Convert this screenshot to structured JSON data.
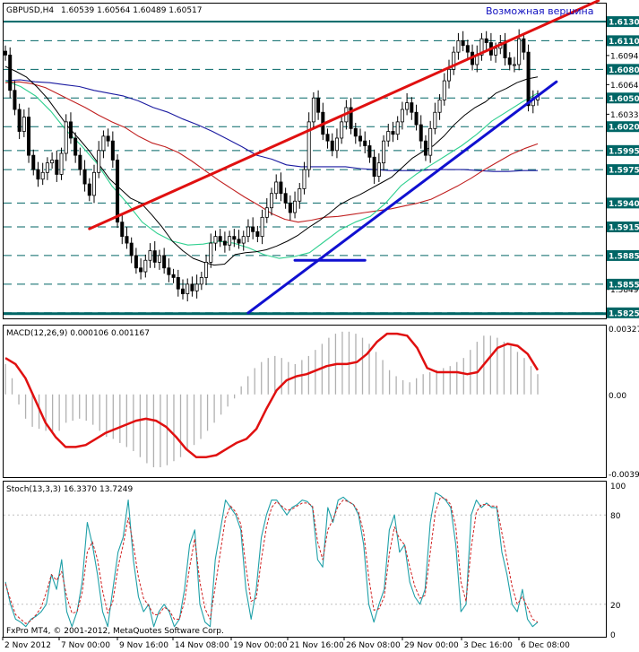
{
  "header": {
    "symbol": "GBPUSD,H4",
    "ohlc": "1.60539 1.60564 1.60489 1.60517"
  },
  "annotation": "Возможная вершина",
  "footer": "FxPro MT4, © 2001-2012, MetaQuotes Software Corp.",
  "colors": {
    "price_box": "#006666",
    "dash_line": "#006666",
    "candle": "#000000",
    "red_channel": "#e01010",
    "blue_trend": "#1010d0",
    "ma_black": "#000000",
    "ma_navy": "#1a1aa0",
    "ma_red": "#c02020",
    "ma_green": "#2fd090",
    "macd_hist": "#b0b0b0",
    "macd_signal": "#e01010",
    "stoch_main": "#1fa0a8",
    "stoch_signal": "#d02020",
    "annotation": "#1010c0"
  },
  "chart_data": [
    {
      "type": "candlestick",
      "title": "GBPUSD,H4",
      "ylim": [
        1.5822,
        1.6147
      ],
      "x_tick_labels": [
        "2 Nov 2012",
        "7 Nov 00:00",
        "9 Nov 16:00",
        "14 Nov 08:00",
        "19 Nov 00:00",
        "21 Nov 16:00",
        "26 Nov 08:00",
        "29 Nov 00:00",
        "3 Dec 16:00",
        "6 Dec 08:00"
      ],
      "y_tick_labels": [
        "1.61300",
        "1.61100",
        "1.60945",
        "1.60800",
        "1.60640",
        "1.60500",
        "1.60330",
        "1.60200",
        "1.59950",
        "1.59750",
        "1.59400",
        "1.59150",
        "1.58850",
        "1.58495",
        "1.58550",
        "1.58250"
      ],
      "levels": [
        1.613,
        1.611,
        1.608,
        1.605,
        1.602,
        1.5995,
        1.5975,
        1.594,
        1.5915,
        1.5885,
        1.5855,
        1.5825
      ],
      "highlighted_levels": [
        "1.61300",
        "1.61100",
        "1.60800",
        "1.60500",
        "1.60200",
        "1.59950",
        "1.59750",
        "1.59400",
        "1.59150",
        "1.58850",
        "1.58550",
        "1.58250"
      ],
      "close": [
        1.6095,
        1.6058,
        1.6038,
        1.6015,
        1.603,
        1.599,
        1.5975,
        1.5965,
        1.5972,
        1.5982,
        1.5985,
        1.597,
        1.5992,
        1.6025,
        1.6008,
        1.599,
        1.5975,
        1.596,
        1.5948,
        1.5972,
        1.5995,
        1.601,
        1.6005,
        1.5985,
        1.592,
        1.5905,
        1.5898,
        1.5885,
        1.5872,
        1.5868,
        1.588,
        1.589,
        1.5878,
        1.5885,
        1.5872,
        1.5865,
        1.5862,
        1.585,
        1.5845,
        1.5855,
        1.5848,
        1.5855,
        1.5862,
        1.5878,
        1.5898,
        1.5905,
        1.59,
        1.5896,
        1.5905,
        1.5902,
        1.5898,
        1.5905,
        1.5915,
        1.591,
        1.5905,
        1.5925,
        1.5935,
        1.595,
        1.5962,
        1.595,
        1.594,
        1.593,
        1.5942,
        1.5955,
        1.5975,
        1.6025,
        1.605,
        1.6035,
        1.6012,
        1.6005,
        1.5995,
        1.6008,
        1.6025,
        1.604,
        1.6018,
        1.601,
        1.6005,
        1.6,
        1.5988,
        1.5968,
        1.5982,
        1.6005,
        1.6015,
        1.6012,
        1.6025,
        1.6038,
        1.6045,
        1.6035,
        1.6022,
        1.6005,
        1.599,
        1.6018,
        1.6035,
        1.6048,
        1.6068,
        1.608,
        1.6098,
        1.611,
        1.6105,
        1.6098,
        1.6085,
        1.6095,
        1.6112,
        1.6108,
        1.6095,
        1.6102,
        1.6108,
        1.6092,
        1.6085,
        1.6085,
        1.6112,
        1.6098,
        1.6042,
        1.6048,
        1.6052
      ],
      "ma_black": [
        1.6083,
        1.6078,
        1.6072,
        1.6062,
        1.605,
        1.6035,
        1.602,
        1.6008,
        1.5995,
        1.598,
        1.5965,
        1.5955,
        1.5945,
        1.594,
        1.5928,
        1.5915,
        1.59,
        1.589,
        1.5882,
        1.5878,
        1.5875,
        1.5876,
        1.5886,
        1.5888,
        1.5889,
        1.5891,
        1.5895,
        1.59,
        1.5906,
        1.5914,
        1.5921,
        1.5929,
        1.5938,
        1.5944,
        1.5949,
        1.5955,
        1.5961,
        1.5967,
        1.5977,
        1.5987,
        1.5994,
        1.6,
        1.601,
        1.6022,
        1.6032,
        1.604,
        1.6046,
        1.6055,
        1.606,
        1.6066,
        1.607,
        1.6072
      ],
      "ma_navy": [
        1.6068,
        1.6069,
        1.6067,
        1.6066,
        1.6064,
        1.6062,
        1.6058,
        1.6055,
        1.6052,
        1.6047,
        1.604,
        1.6035,
        1.6028,
        1.6022,
        1.6015,
        1.6007,
        1.5999,
        1.599,
        1.5986,
        1.598,
        1.5978,
        1.5978,
        1.5978,
        1.5978,
        1.5976,
        1.5975,
        1.5974,
        1.5974,
        1.5974,
        1.5975,
        1.5975,
        1.5975,
        1.5974,
        1.5973,
        1.5973,
        1.5974,
        1.5974
      ],
      "ma_red": [
        1.6066,
        1.6067,
        1.6065,
        1.6061,
        1.6054,
        1.6047,
        1.604,
        1.6032,
        1.6025,
        1.6019,
        1.601,
        1.6003,
        1.5999,
        1.5993,
        1.5984,
        1.5974,
        1.5964,
        1.5955,
        1.5946,
        1.5938,
        1.5929,
        1.5923,
        1.592,
        1.5922,
        1.5925,
        1.5926,
        1.5928,
        1.593,
        1.5932,
        1.5934,
        1.5937,
        1.594,
        1.5944,
        1.5951,
        1.5958,
        1.5966,
        1.5975,
        1.5983,
        1.5991,
        1.5997,
        1.6002
      ],
      "ma_green": [
        1.6068,
        1.6062,
        1.6052,
        1.6036,
        1.6016,
        1.6,
        1.5982,
        1.5958,
        1.594,
        1.592,
        1.5908,
        1.59,
        1.5896,
        1.5897,
        1.59,
        1.5898,
        1.5893,
        1.5886,
        1.5882,
        1.5884,
        1.5888,
        1.59,
        1.5912,
        1.592,
        1.5926,
        1.594,
        1.5958,
        1.597,
        1.598,
        1.599,
        1.6,
        1.6012,
        1.6026,
        1.6036,
        1.6046,
        1.6055
      ],
      "red_channel": [
        [
          18,
          1.5913
        ],
        [
          127,
          1.6152
        ]
      ],
      "blue_trendline": [
        [
          52,
          1.5825
        ],
        [
          118,
          1.6067
        ]
      ],
      "blue_support": [
        [
          62,
          1.588
        ],
        [
          77,
          1.588
        ]
      ]
    },
    {
      "type": "bar",
      "title": "MACD(12,26,9) 0.000106 0.001167",
      "ylim": [
        -0.00391,
        0.00327
      ],
      "y_tick_labels": [
        "0.00327",
        "0.00",
        "-0.00391"
      ],
      "histogram": [
        0.0015,
        0.0008,
        -0.0005,
        -0.0012,
        -0.0016,
        -0.0017,
        -0.0018,
        -0.0019,
        -0.0018,
        -0.0014,
        -0.0013,
        -0.0012,
        -0.0013,
        -0.0015,
        -0.0018,
        -0.0021,
        -0.0022,
        -0.0024,
        -0.0026,
        -0.0028,
        -0.0031,
        -0.0034,
        -0.0036,
        -0.0036,
        -0.0035,
        -0.0033,
        -0.0031,
        -0.0028,
        -0.0025,
        -0.0022,
        -0.0018,
        -0.0014,
        -0.001,
        -0.0006,
        -0.0002,
        0.0004,
        0.0009,
        0.0013,
        0.0016,
        0.0018,
        0.0019,
        0.0018,
        0.0016,
        0.0015,
        0.0017,
        0.0019,
        0.0022,
        0.0025,
        0.0028,
        0.003,
        0.0031,
        0.0031,
        0.003,
        0.0028,
        0.0025,
        0.0021,
        0.0017,
        0.0012,
        0.0009,
        0.0007,
        0.0006,
        0.0008,
        0.001,
        0.0011,
        0.0012,
        0.0013,
        0.0014,
        0.0016,
        0.0018,
        0.0022,
        0.0026,
        0.0029,
        0.0029,
        0.0028,
        0.0026,
        0.0024,
        0.0021,
        0.0018,
        0.0014,
        0.001
      ],
      "signal": [
        0.0018,
        0.0015,
        0.0008,
        -0.0003,
        -0.0014,
        -0.0021,
        -0.0026,
        -0.0026,
        -0.0025,
        -0.0022,
        -0.0019,
        -0.0017,
        -0.0015,
        -0.0013,
        -0.0012,
        -0.0013,
        -0.0016,
        -0.0021,
        -0.0027,
        -0.0031,
        -0.0031,
        -0.003,
        -0.0027,
        -0.0024,
        -0.0022,
        -0.0017,
        -0.0007,
        0.0002,
        0.0007,
        0.0009,
        0.001,
        0.0012,
        0.0014,
        0.0015,
        0.0015,
        0.0016,
        0.002,
        0.0026,
        0.003,
        0.003,
        0.0029,
        0.0023,
        0.0013,
        0.0011,
        0.0011,
        0.0011,
        0.001,
        0.0011,
        0.0017,
        0.0023,
        0.0025,
        0.0024,
        0.002,
        0.0012
      ]
    },
    {
      "type": "line",
      "title": "Stoch(13,3,3) 16.3370 13.7249",
      "ylim": [
        0,
        100
      ],
      "y_tick_labels": [
        "100",
        "80",
        "20",
        "0"
      ],
      "main": [
        35,
        20,
        10,
        8,
        5,
        10,
        12,
        15,
        20,
        40,
        30,
        50,
        15,
        5,
        15,
        35,
        75,
        60,
        40,
        15,
        5,
        30,
        55,
        65,
        90,
        50,
        25,
        15,
        20,
        5,
        15,
        20,
        15,
        5,
        10,
        30,
        60,
        70,
        20,
        8,
        5,
        50,
        70,
        90,
        85,
        80,
        70,
        30,
        10,
        30,
        65,
        80,
        90,
        90,
        85,
        80,
        85,
        87,
        90,
        89,
        85,
        50,
        45,
        85,
        75,
        90,
        92,
        89,
        87,
        80,
        60,
        20,
        8,
        20,
        30,
        70,
        80,
        55,
        60,
        35,
        25,
        20,
        30,
        75,
        95,
        93,
        90,
        85,
        60,
        15,
        20,
        80,
        90,
        85,
        88,
        85,
        85,
        55,
        40,
        20,
        15,
        30,
        10,
        5,
        8
      ],
      "signal": [
        34,
        23,
        13,
        10,
        7,
        9,
        13,
        18,
        28,
        40,
        36,
        42,
        25,
        14,
        15,
        28,
        55,
        62,
        50,
        29,
        14,
        22,
        45,
        60,
        78,
        60,
        38,
        24,
        19,
        13,
        13,
        18,
        16,
        10,
        10,
        22,
        45,
        64,
        35,
        17,
        10,
        32,
        55,
        78,
        86,
        82,
        74,
        45,
        22,
        24,
        50,
        72,
        85,
        89,
        86,
        83,
        84,
        86,
        88,
        88,
        86,
        62,
        50,
        70,
        77,
        86,
        90,
        89,
        87,
        82,
        68,
        38,
        16,
        17,
        25,
        54,
        72,
        64,
        60,
        45,
        32,
        24,
        26,
        55,
        82,
        92,
        91,
        87,
        72,
        35,
        22,
        58,
        82,
        87,
        87,
        86,
        86,
        68,
        50,
        32,
        20,
        25,
        18,
        10,
        8
      ]
    }
  ]
}
